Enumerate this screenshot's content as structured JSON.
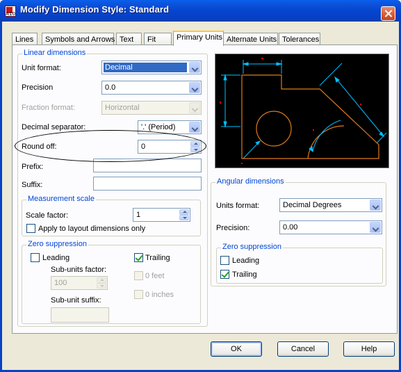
{
  "window": {
    "title": "Modify Dimension Style: Standard",
    "app_icon_text": "A10"
  },
  "tabs": [
    {
      "label": "Lines"
    },
    {
      "label": "Symbols and Arrows"
    },
    {
      "label": "Text"
    },
    {
      "label": "Fit"
    },
    {
      "label": "Primary Units",
      "active": true
    },
    {
      "label": "Alternate Units"
    },
    {
      "label": "Tolerances"
    }
  ],
  "linear": {
    "group_label": "Linear dimensions",
    "unit_format_label": "Unit format:",
    "unit_format_value": "Decimal",
    "precision_label": "Precision",
    "precision_value": "0.0",
    "fraction_format_label": "Fraction format:",
    "fraction_format_value": "Horizontal",
    "decimal_separator_label": "Decimal separator:",
    "decimal_separator_value": "'.' (Period)",
    "round_off_label": "Round off:",
    "round_off_value": "0",
    "prefix_label": "Prefix:",
    "prefix_value": "",
    "suffix_label": "Suffix:",
    "suffix_value": ""
  },
  "measurement": {
    "group_label": "Measurement scale",
    "scale_factor_label": "Scale factor:",
    "scale_factor_value": "1",
    "layout_only_label": "Apply to layout dimensions only",
    "layout_only_checked": false
  },
  "zero_linear": {
    "group_label": "Zero suppression",
    "leading_label": "Leading",
    "leading_checked": false,
    "trailing_label": "Trailing",
    "trailing_checked": true,
    "subunits_factor_label": "Sub-units factor:",
    "subunits_factor_value": "100",
    "zero_feet_label": "0 feet",
    "zero_inches_label": "0 inches",
    "subunit_suffix_label": "Sub-unit suffix:",
    "subunit_suffix_value": ""
  },
  "angular": {
    "group_label": "Angular dimensions",
    "units_format_label": "Units format:",
    "units_format_value": "Decimal Degrees",
    "precision_label": "Precision:",
    "precision_value": "0.00"
  },
  "zero_angular": {
    "group_label": "Zero suppression",
    "leading_label": "Leading",
    "leading_checked": false,
    "trailing_label": "Trailing",
    "trailing_checked": true
  },
  "buttons": {
    "ok": "OK",
    "cancel": "Cancel",
    "help": "Help"
  },
  "colors": {
    "titlebar": "#0A5FEF",
    "preview_bg": "#000000",
    "dimension_lines": "#00BFFF",
    "geometry": "#E07A1A",
    "accent_marks": "#FF0000"
  }
}
